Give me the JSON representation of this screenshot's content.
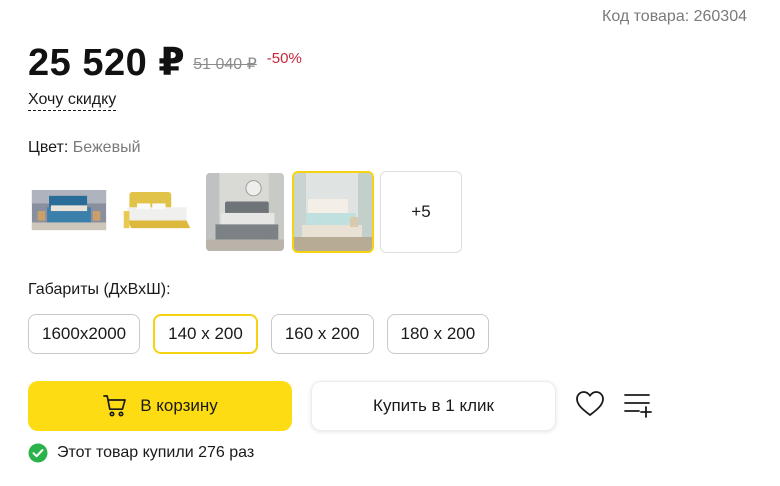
{
  "product": {
    "sku_text": "Код товара: 260304",
    "price_current": "25 520 ₽",
    "price_old": "51 040 ₽",
    "discount": "-50%",
    "want_discount_link": "Хочу скидку"
  },
  "color": {
    "label": "Цвет:",
    "value": "Бежевый",
    "swatches": [
      {
        "icon": "bed-blue-thumbnail"
      },
      {
        "icon": "bed-yellow-thumbnail"
      },
      {
        "icon": "bed-grey-thumbnail"
      },
      {
        "icon": "bed-beige-thumbnail",
        "selected": true
      }
    ],
    "more_label": "+5"
  },
  "sizes": {
    "label": "Габариты (ДхВхШ):",
    "options": [
      "1600x2000",
      "140 x 200",
      "160 x 200",
      "180 x 200"
    ],
    "active_index": 1
  },
  "actions": {
    "cart_label": "В корзину",
    "one_click_label": "Купить в 1 клик",
    "cart_icon": "cart-icon",
    "favorite_icon": "heart-icon",
    "compare_icon": "compare-list-icon"
  },
  "social_proof": {
    "text": "Этот товар купили 276 раз",
    "icon": "check-circle-icon"
  },
  "colors": {
    "accent": "#fddc13",
    "selected_border": "#f5d311",
    "discount": "#c4273b",
    "success": "#2bb34b"
  }
}
